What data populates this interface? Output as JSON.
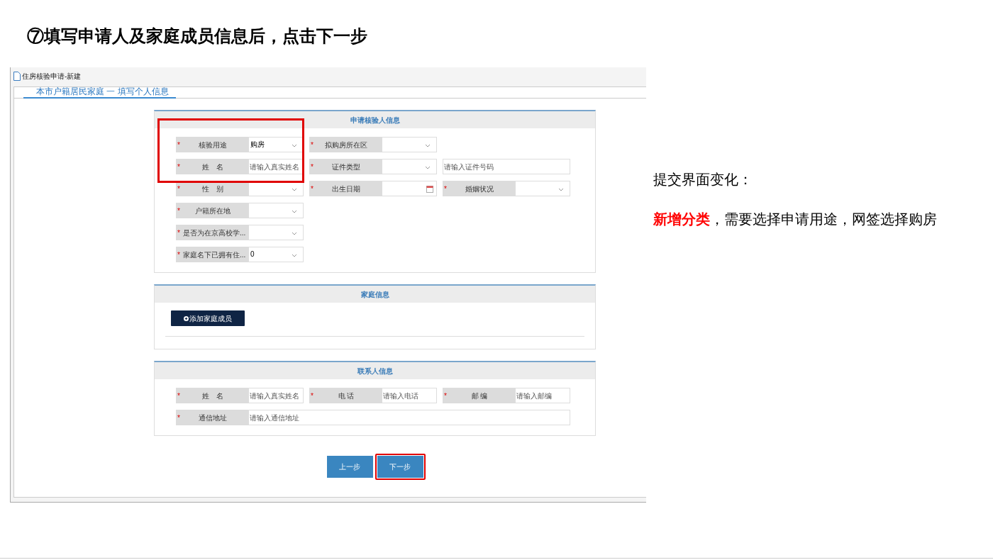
{
  "slide_title": "⑦填写申请人及家庭成员信息后，点击下一步",
  "window": {
    "title": "住房核验申请-新建",
    "tab": "本市户籍居民家庭 一 填写个人信息"
  },
  "sections": [
    {
      "title": "申请核验人信息",
      "rows": [
        [
          {
            "kind": "select",
            "mark": "*",
            "label": "核验用途",
            "value": "购房"
          },
          {
            "kind": "select",
            "mark": "*",
            "label": "拟购房所在区"
          }
        ],
        [
          {
            "kind": "text",
            "mark": "*",
            "label": "姓　名",
            "placeholder": "请输入真实姓名"
          },
          {
            "kind": "select",
            "mark": "*",
            "label": "证件类型"
          },
          {
            "kind": "plain",
            "placeholder": "请输入证件号码"
          }
        ],
        [
          {
            "kind": "select",
            "mark": "*",
            "label": "性　别"
          },
          {
            "kind": "date",
            "mark": "*",
            "label": "出生日期"
          },
          {
            "kind": "select",
            "mark": "*",
            "label": "婚姻状况"
          }
        ],
        [
          {
            "kind": "select",
            "mark": "*",
            "label": "户籍所在地"
          }
        ],
        [
          {
            "kind": "select",
            "mark": "*",
            "label": "是否为在京高校学..."
          }
        ],
        [
          {
            "kind": "select",
            "mark": "*",
            "label": "家庭名下已拥有住...",
            "value": "0"
          }
        ]
      ]
    },
    {
      "title": "家庭信息",
      "button": "添加家庭成员"
    },
    {
      "title": "联系人信息",
      "rows": [
        [
          {
            "kind": "text",
            "mark": "*",
            "label": "姓　名",
            "placeholder": "请输入真实姓名"
          },
          {
            "kind": "text",
            "mark": "*",
            "label": "电 话",
            "placeholder": "请输入电话"
          },
          {
            "kind": "text",
            "mark": "*",
            "label": "邮 编",
            "placeholder": "请输入邮编"
          }
        ],
        [
          {
            "kind": "text",
            "mark": "*",
            "label": "通信地址",
            "placeholder": "请输入通信地址",
            "wide": true
          }
        ]
      ]
    }
  ],
  "buttons": [
    {
      "label": "上一步",
      "highlighted": false
    },
    {
      "label": "下一步",
      "highlighted": true
    }
  ],
  "note": {
    "heading": "提交界面变化：",
    "text": "**新增分类**，需要选择申请用途，网签选择购房"
  }
}
